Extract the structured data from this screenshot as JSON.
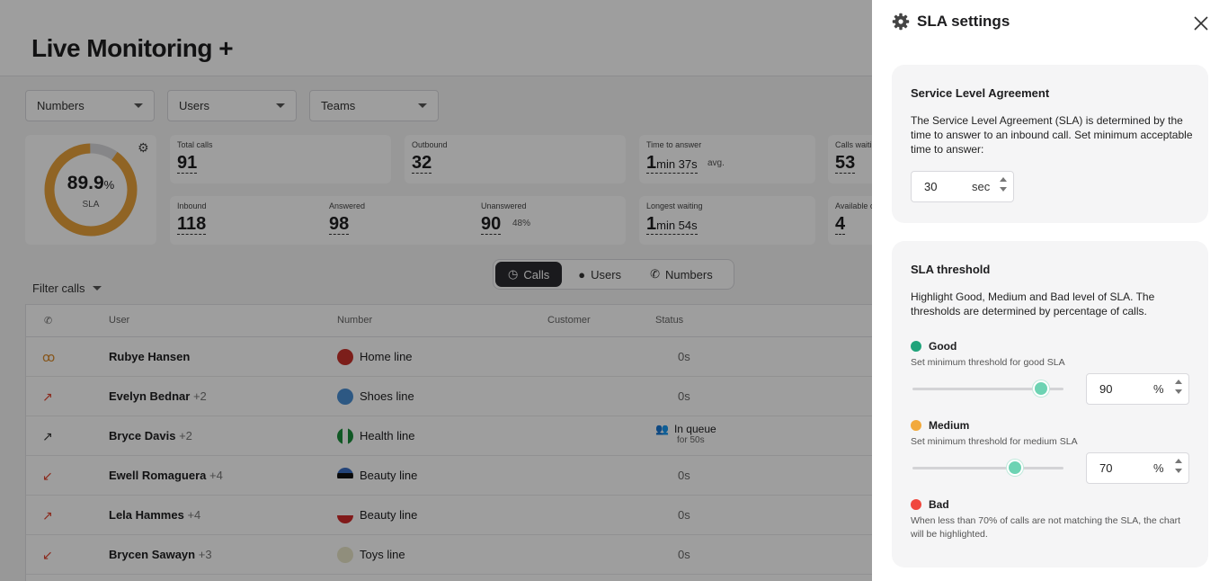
{
  "dashboard": {
    "title": "Live Monitoring +",
    "filters": [
      "Numbers",
      "Users",
      "Teams"
    ],
    "sla_value": "89.9",
    "sla_percent": "%",
    "sla_label": "SLA",
    "stats": {
      "total_calls": {
        "label": "Total calls",
        "value": "91"
      },
      "outbound": {
        "label": "Outbound",
        "value": "32"
      },
      "time_to_answer": {
        "label": "Time to answer",
        "value": "1",
        "unit": "min 37s",
        "extra": "avg."
      },
      "calls_waiting": {
        "label": "Calls waiti",
        "value": "53"
      },
      "inbound": {
        "label": "Inbound",
        "value": "118"
      },
      "answered": {
        "label": "Answered",
        "value": "98"
      },
      "unanswered": {
        "label": "Unanswered",
        "value": "90",
        "extra": "48%"
      },
      "longest_waiting": {
        "label": "Longest waiting",
        "value": "1",
        "unit": "min 54s"
      },
      "available": {
        "label": "Available c",
        "value": "4"
      }
    },
    "filter_calls": "Filter calls",
    "view_toggle": [
      "Calls",
      "Users",
      "Numbers"
    ],
    "table_headers": {
      "user": "User",
      "number": "Number",
      "customer": "Customer",
      "status": "Status"
    },
    "rows": [
      {
        "user": "Rubye Hansen",
        "extra": "",
        "number": "Home line",
        "status": "0s"
      },
      {
        "user": "Evelyn Bednar",
        "extra": "+2",
        "number": "Shoes line",
        "status": "0s"
      },
      {
        "user": "Bryce Davis",
        "extra": "+2",
        "number": "Health line",
        "status": "In queue",
        "status_sub": "for 50s"
      },
      {
        "user": "Ewell Romaguera",
        "extra": "+4",
        "number": "Beauty line",
        "status": "0s"
      },
      {
        "user": "Lela Hammes",
        "extra": "+4",
        "number": "Beauty line",
        "status": "0s"
      },
      {
        "user": "Brycen Sawayn",
        "extra": "+3",
        "number": "Toys line",
        "status": "0s"
      }
    ]
  },
  "panel": {
    "title": "SLA settings",
    "sla_card": {
      "heading": "Service Level Agreement",
      "description": "The Service Level Agreement (SLA) is determined by the time to answer to an inbound call. Set minimum acceptable time to answer:",
      "value": "30",
      "unit": "sec"
    },
    "threshold_card": {
      "heading": "SLA threshold",
      "description": "Highlight Good, Medium and Bad level of SLA. The thresholds are determined by percentage of calls.",
      "good": {
        "label": "Good",
        "hint": "Set minimum threshold for good SLA",
        "value": "90",
        "unit": "%",
        "slider_fraction": 0.85,
        "color": "#1fa37a"
      },
      "medium": {
        "label": "Medium",
        "hint": "Set minimum threshold for medium SLA",
        "value": "70",
        "unit": "%",
        "slider_fraction": 0.68,
        "color": "#f2a93b"
      },
      "bad": {
        "label": "Bad",
        "hint": "When less than 70% of calls are not matching the SLA, the chart will be highlighted.",
        "color": "#f0483e"
      }
    }
  }
}
